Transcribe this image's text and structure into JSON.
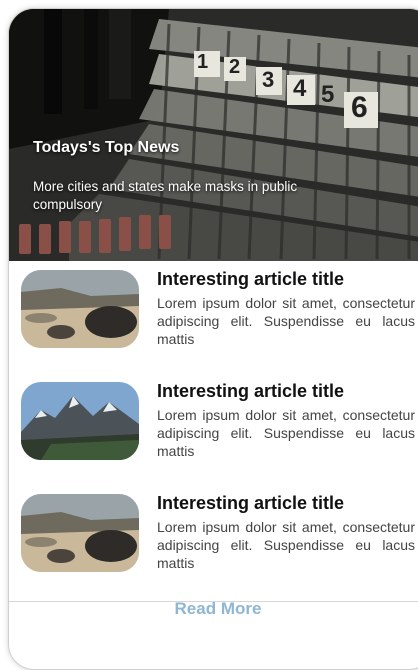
{
  "hero": {
    "title": "Todays's Top News",
    "subtitle": "More cities and states make masks in public compulsory",
    "sign_numbers": [
      "1",
      "2",
      "3",
      "4",
      "5",
      "6"
    ]
  },
  "articles": [
    {
      "title": "Interesting article title",
      "body": "Lorem ipsum dolor sit amet, consectetur adipiscing elit. Suspendisse eu lacus mattis",
      "thumbnail": "beach-rocks-photo"
    },
    {
      "title": "Interesting article title",
      "body": "Lorem ipsum dolor sit amet, consectetur adipiscing elit. Suspendisse eu lacus mattis",
      "thumbnail": "mountain-lake-photo"
    },
    {
      "title": "Interesting article title",
      "body": "Lorem ipsum dolor sit amet, consectetur adipiscing elit. Suspendisse eu lacus mattis",
      "thumbnail": "beach-rocks-photo"
    }
  ],
  "read_more": "Read More",
  "colors": {
    "link": "#8fb6d3",
    "divider": "#d7d7d7"
  }
}
